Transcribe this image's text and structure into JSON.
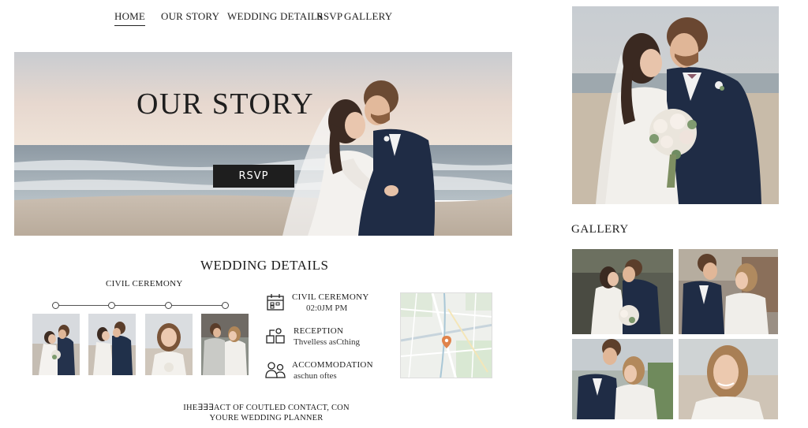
{
  "nav": {
    "items": [
      {
        "label": "HOME",
        "active": true
      },
      {
        "label": "OUR STORY",
        "active": false
      },
      {
        "label": "WEDDING DETAILS",
        "active": false
      },
      {
        "label": "RSVP",
        "active": false
      },
      {
        "label": "GALLERY",
        "active": false
      }
    ]
  },
  "hero": {
    "title": "OUR STORY",
    "button_label": "RSVP"
  },
  "details": {
    "title": "WEDDING DETAILS",
    "timeline_label": "CIVIL CEREMONY",
    "items": [
      {
        "title": "CIVIL CEREMONY",
        "subtitle": "02:0ЈM PM",
        "icon": "calendar-icon"
      },
      {
        "title": "RECEPTION",
        "subtitle": "Thvelless asCthing",
        "icon": "party-icon"
      },
      {
        "title": "ACCOMMODATION",
        "subtitle": "aschun oftes",
        "icon": "people-icon"
      }
    ]
  },
  "contact": {
    "line1": "IHE∃∃∃ACT OF COUTLED CONTACT, CON",
    "line2": "YOURE WEDDING PLANNER"
  },
  "gallery": {
    "title": "GALLERY"
  },
  "colors": {
    "text": "#1c1c1c",
    "button_bg": "#1e1e1e",
    "suit_navy": "#1f2c45",
    "map_pin": "#e0834a"
  }
}
